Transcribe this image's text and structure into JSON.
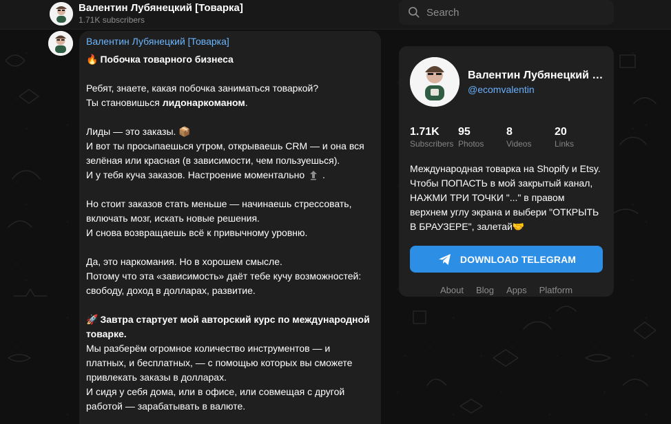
{
  "header": {
    "title": "Валентин Лубянецкий [Товарка]",
    "subscribers": "1.71K subscribers"
  },
  "search": {
    "placeholder": "Search",
    "value": ""
  },
  "message": {
    "author": "Валентин Лубянецкий [Товарка]",
    "lines": {
      "l1_emoji": "🔥",
      "l1_text": "Побочка товарного бизнеса",
      "l2": "Ребят, знаете, какая побочка заниматься товаркой?",
      "l3_prefix": "Ты становишься ",
      "l3_strong": "лидонаркоманом",
      "l3_suffix": ".",
      "l4_text": "Лиды — это заказы.",
      "l4_emoji": "📦",
      "l5": "И вот ты просыпаешься утром, открываешь CRM — и она вся",
      "l6": "зелёная или красная (в зависимости, чем пользуешься).",
      "l7_text": "И у тебя куча заказов. Настроение моментально",
      "l7_suffix": ".",
      "l8": "Но стоит заказов стать меньше — начинаешь стрессовать,",
      "l9": "включать мозг, искать новые решения.",
      "l10": "И снова возвращаешь всё к привычному уровню.",
      "l11": "Да, это наркомания. Но в хорошем смысле.",
      "l12": "Потому что эта «зависимость» даёт тебе кучу возможностей:",
      "l13": "свободу, доход в долларах, развитие.",
      "l14_emoji": "🚀",
      "l14_text": "Завтра стартует мой авторский курс по международной",
      "l15": "товарке.",
      "l16": "Мы разберём огромное количество инструментов — и",
      "l17": "платных, и бесплатных, — с помощью которых вы сможете",
      "l18": "привлекать заказы в долларах.",
      "l19": "И сидя у себя дома, или в офисе, или совмещая с другой",
      "l20": "работой — зарабатывать в валюте."
    }
  },
  "profile": {
    "name": "Валентин Лубянецкий [Т...",
    "handle": "@ecomvalentin",
    "stats": [
      {
        "value": "1.71K",
        "label": "Subscribers"
      },
      {
        "value": "95",
        "label": "Photos"
      },
      {
        "value": "8",
        "label": "Videos"
      },
      {
        "value": "20",
        "label": "Links"
      }
    ],
    "description_lines": [
      "Международная товарка на Shopify и Etsy.",
      "Чтобы ПОПАСТЬ в мой закрытый канал,",
      "НАЖМИ ТРИ ТОЧКИ \"...\" в правом",
      "верхнем углу экрана и выбери \"ОТКРЫТЬ",
      "В БРАУЗЕРЕ\", залетай🤝"
    ],
    "download_label": "DOWNLOAD TELEGRAM",
    "footer_links": [
      "About",
      "Blog",
      "Apps",
      "Platform"
    ]
  },
  "colors": {
    "accent": "#2d8ee6",
    "link": "#69b0ff",
    "card": "#202020",
    "bubble": "#1f1f1f"
  },
  "icons": {
    "search": "search-icon",
    "telegram": "telegram-icon",
    "mood": "arrow-up-icon"
  }
}
